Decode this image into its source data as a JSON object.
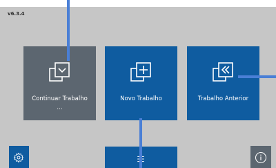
{
  "app": {
    "version": "v6.3.4"
  },
  "tiles": [
    {
      "label": "Continuar Trabalho\n…",
      "icon": "continue-work-icon",
      "state": "disabled"
    },
    {
      "label": "Novo Trabalho",
      "icon": "new-work-icon"
    },
    {
      "label": "Trabalho Anterior",
      "icon": "previous-work-icon"
    }
  ],
  "bottom_bar": {
    "settings_icon": "gear-icon",
    "menu_icon": "hamburger-menu-icon",
    "info_icon": "info-icon"
  },
  "colors": {
    "background": "#c6c6c6",
    "tile_blue": "#0f5ca0",
    "tile_gray": "#5c6670",
    "annotation_line": "#4a7fd6"
  }
}
